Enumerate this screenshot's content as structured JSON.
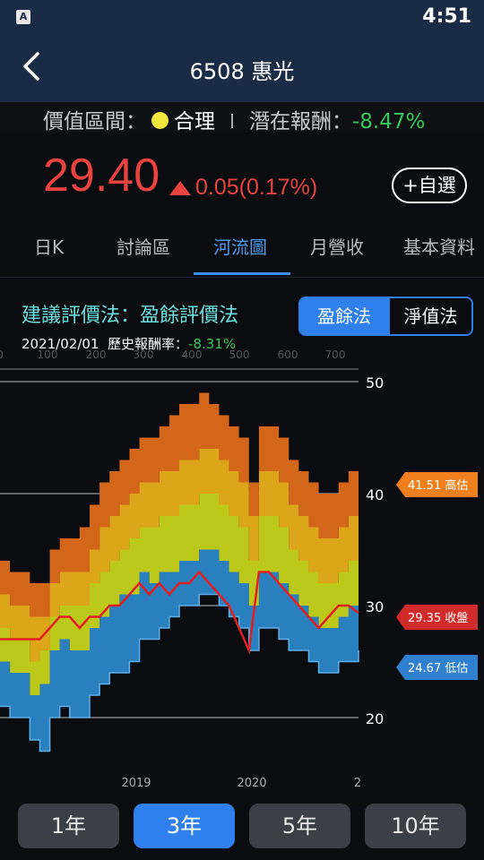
{
  "status": {
    "time": "4:51",
    "app_icon": "A"
  },
  "nav": {
    "title": "6508 惠光",
    "back_icon": "chevron-left-icon"
  },
  "valuation": {
    "range_label": "價值區間：",
    "level": "合理",
    "level_color": "#f0e63c",
    "return_label": "潛在報酬：",
    "return_value": "-8.47%"
  },
  "quote": {
    "price": "29.40",
    "change": "0.05(0.17%)",
    "change_color": "#e8433e",
    "favorite_label": "+自選"
  },
  "tabs": [
    {
      "label": "日K",
      "active": false
    },
    {
      "label": "討論區",
      "active": false
    },
    {
      "label": "河流圖",
      "active": true
    },
    {
      "label": "月營收",
      "active": false
    },
    {
      "label": "基本資料",
      "active": false
    }
  ],
  "method": {
    "title": "建議評價法：盈餘評價法",
    "options": [
      "盈餘法",
      "淨值法"
    ],
    "selected": "盈餘法"
  },
  "history": {
    "date": "2021/02/01",
    "label": "歷史報酬率：",
    "value": "-8.31%"
  },
  "chart_data": {
    "type": "area",
    "y_ticks": [
      50,
      40,
      30,
      20
    ],
    "ylim": [
      16,
      52
    ],
    "x_tick_labels": [
      "2019",
      "2020",
      "2"
    ],
    "top_axis_labels": [
      "0",
      "100",
      "200",
      "300",
      "400",
      "500",
      "600",
      "700"
    ],
    "x": [
      "2018-02",
      "2018-03",
      "2018-04",
      "2018-05",
      "2018-06",
      "2018-07",
      "2018-08",
      "2018-09",
      "2018-10",
      "2018-11",
      "2018-12",
      "2019-01",
      "2019-02",
      "2019-03",
      "2019-04",
      "2019-05",
      "2019-06",
      "2019-07",
      "2019-08",
      "2019-09",
      "2019-10",
      "2019-11",
      "2019-12",
      "2020-01",
      "2020-02",
      "2020-03",
      "2020-04",
      "2020-05",
      "2020-06",
      "2020-07",
      "2020-08",
      "2020-09",
      "2020-10",
      "2020-11",
      "2020-12",
      "2021-01",
      "2021-02"
    ],
    "band_bounds": {
      "b0": [
        21,
        20,
        20,
        18,
        17,
        20,
        21,
        20,
        20,
        22,
        23,
        24,
        24,
        25,
        27,
        27,
        28,
        29,
        30,
        30,
        31,
        31,
        30,
        29,
        28,
        26,
        28,
        28,
        27,
        26,
        26,
        25,
        24,
        24,
        25,
        25,
        26
      ],
      "b1": [
        25,
        24,
        24,
        22,
        23,
        26,
        27,
        26,
        26,
        28,
        29,
        30,
        31,
        31,
        33,
        32,
        33,
        33,
        34,
        34,
        35,
        35,
        34,
        33,
        32,
        30,
        33,
        33,
        32,
        31,
        30,
        29,
        28,
        28,
        29,
        30,
        30
      ],
      "b2": [
        28,
        27,
        27,
        25,
        26,
        29,
        30,
        30,
        30,
        32,
        33,
        34,
        35,
        36,
        37,
        37,
        38,
        38,
        39,
        39,
        40,
        40,
        39,
        38,
        37,
        34,
        38,
        38,
        37,
        35,
        34,
        33,
        32,
        32,
        33,
        34,
        34
      ],
      "b3": [
        31,
        30,
        30,
        29,
        29,
        32,
        33,
        33,
        33,
        35,
        37,
        38,
        39,
        40,
        41,
        41,
        42,
        42,
        43,
        43,
        44,
        44,
        43,
        42,
        41,
        38,
        42,
        42,
        41,
        39,
        38,
        37,
        36,
        36,
        37,
        38,
        38
      ],
      "b4": [
        34,
        33,
        33,
        32,
        32,
        35,
        36,
        36,
        37,
        39,
        41,
        42,
        43,
        44,
        45,
        45,
        46,
        47,
        48,
        48,
        49,
        48,
        47,
        46,
        45,
        41,
        46,
        46,
        45,
        43,
        42,
        41,
        40,
        40,
        41,
        42,
        42
      ]
    },
    "close": [
      27,
      27,
      27,
      27,
      27,
      28,
      29,
      29,
      28,
      29,
      29,
      30,
      30,
      31,
      32,
      31,
      32,
      31,
      32,
      32,
      33,
      32,
      31,
      30,
      28,
      26,
      33,
      33,
      32,
      31,
      30,
      29,
      28,
      29,
      30,
      30,
      29.35
    ],
    "band_colors": [
      "#2a7fbf",
      "#bcc81a",
      "#dca51a",
      "#d4661a"
    ],
    "close_color": "#e02020",
    "markers": [
      {
        "label": "41.51 高估",
        "color": "#f0801e"
      },
      {
        "label": "29.35 收盤",
        "color": "#d12a2a"
      },
      {
        "label": "24.67 低估",
        "color": "#2f80cf"
      }
    ]
  },
  "periods": [
    {
      "label": "1年",
      "active": false
    },
    {
      "label": "3年",
      "active": true
    },
    {
      "label": "5年",
      "active": false
    },
    {
      "label": "10年",
      "active": false
    }
  ]
}
